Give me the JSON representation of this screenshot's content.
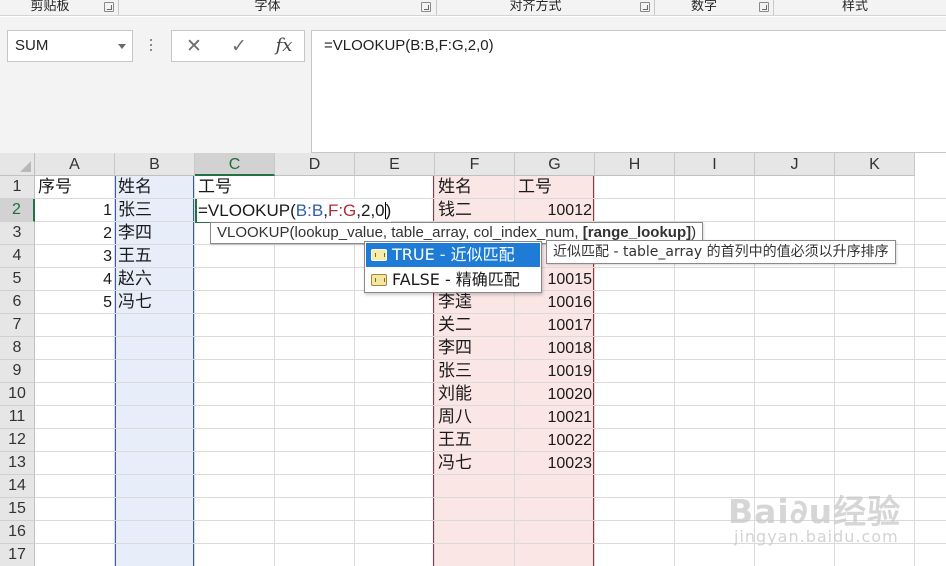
{
  "ribbon": {
    "groups": [
      "剪贴板",
      "字体",
      "对齐方式",
      "数字",
      "样式"
    ]
  },
  "formula_bar": {
    "name_box": "SUM",
    "cancel_icon": "close-icon",
    "enter_icon": "check-icon",
    "fx_label": "fx",
    "formula": "=VLOOKUP(B:B,F:G,2,0)"
  },
  "grid": {
    "columns": [
      "A",
      "B",
      "C",
      "D",
      "E",
      "F",
      "G",
      "H",
      "I",
      "J",
      "K"
    ],
    "selected_column": "C",
    "rows": [
      "1",
      "2",
      "3",
      "4",
      "5",
      "6",
      "7",
      "8",
      "9",
      "10",
      "11",
      "12",
      "13",
      "14",
      "15",
      "16",
      "17"
    ],
    "selected_row": "2",
    "header_row": {
      "A": "序号",
      "B": "姓名",
      "C": "工号",
      "F": "姓名",
      "G": "工号"
    },
    "left_table": [
      {
        "no": "1",
        "name": "张三"
      },
      {
        "no": "2",
        "name": "李四"
      },
      {
        "no": "3",
        "name": "王五"
      },
      {
        "no": "4",
        "name": "赵六"
      },
      {
        "no": "5",
        "name": "冯七"
      }
    ],
    "right_table": [
      {
        "name": "钱二",
        "id": "10012"
      },
      {
        "name": "",
        "id": ""
      },
      {
        "name": "",
        "id": ""
      },
      {
        "name": "",
        "id": "10015"
      },
      {
        "name": "李逵",
        "id": "10016"
      },
      {
        "name": "关二",
        "id": "10017"
      },
      {
        "name": "李四",
        "id": "10018"
      },
      {
        "name": "张三",
        "id": "10019"
      },
      {
        "name": "刘能",
        "id": "10020"
      },
      {
        "name": "周八",
        "id": "10021"
      },
      {
        "name": "王五",
        "id": "10022"
      },
      {
        "name": "冯七",
        "id": "10023"
      }
    ],
    "editing_cell": {
      "prefix": "=VLOOKUP(",
      "ref_b": "B:B",
      "comma1": ",",
      "ref_fg": "F:G",
      "suffix": ",2,0"
    }
  },
  "tooltip": {
    "prefix": "VLOOKUP(lookup_value, table_array, col_index_num, ",
    "bold_arg": "[range_lookup]",
    "suffix": ")"
  },
  "autocomplete": {
    "items": [
      {
        "label": "TRUE - 近似匹配",
        "highlighted": true
      },
      {
        "label": "FALSE - 精确匹配",
        "highlighted": false
      }
    ],
    "description": "近似匹配 - table_array 的首列中的值必须以升序排序"
  },
  "watermark": {
    "logo": "Bai∂u经验",
    "url": "jingyan.baidu.com"
  },
  "colors": {
    "excel_green": "#217346",
    "ref_blue": "#2f5fa7",
    "ref_red": "#b02a3a",
    "highlight_blue": "#1e7cd6"
  }
}
